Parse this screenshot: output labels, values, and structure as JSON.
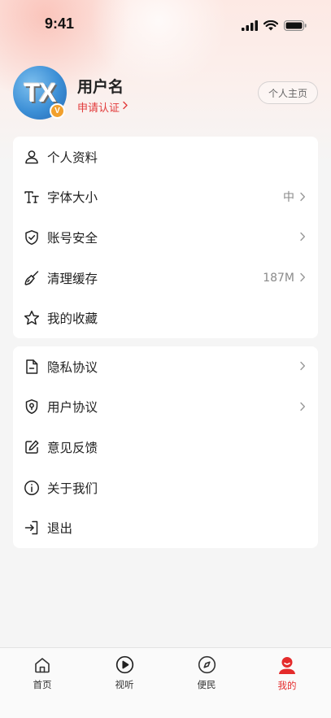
{
  "status_bar": {
    "time": "9:41"
  },
  "profile": {
    "avatar_text": "TX",
    "vip_badge": "V",
    "username": "用户名",
    "verify_label": "申请认证",
    "homepage_button": "个人主页"
  },
  "menu_group1": [
    {
      "label": "个人资料",
      "value": "",
      "chevron": false,
      "icon": "user-icon"
    },
    {
      "label": "字体大小",
      "value": "中",
      "chevron": true,
      "icon": "font-size-icon"
    },
    {
      "label": "账号安全",
      "value": "",
      "chevron": true,
      "icon": "shield-check-icon"
    },
    {
      "label": "清理缓存",
      "value": "187M",
      "chevron": true,
      "icon": "broom-icon"
    },
    {
      "label": "我的收藏",
      "value": "",
      "chevron": false,
      "icon": "star-icon"
    }
  ],
  "menu_group2": [
    {
      "label": "隐私协议",
      "value": "",
      "chevron": true,
      "icon": "document-icon"
    },
    {
      "label": "用户协议",
      "value": "",
      "chevron": true,
      "icon": "location-shield-icon"
    },
    {
      "label": "意见反馈",
      "value": "",
      "chevron": false,
      "icon": "edit-icon"
    },
    {
      "label": "关于我们",
      "value": "",
      "chevron": false,
      "icon": "info-icon"
    },
    {
      "label": "退出",
      "value": "",
      "chevron": false,
      "icon": "logout-icon"
    }
  ],
  "tab_bar": {
    "active_color": "#e42b2b",
    "tabs": [
      {
        "label": "首页",
        "icon": "home-icon",
        "active": false
      },
      {
        "label": "视听",
        "icon": "play-circle-icon",
        "active": false
      },
      {
        "label": "便民",
        "icon": "compass-icon",
        "active": false
      },
      {
        "label": "我的",
        "icon": "person-icon",
        "active": true
      }
    ]
  }
}
